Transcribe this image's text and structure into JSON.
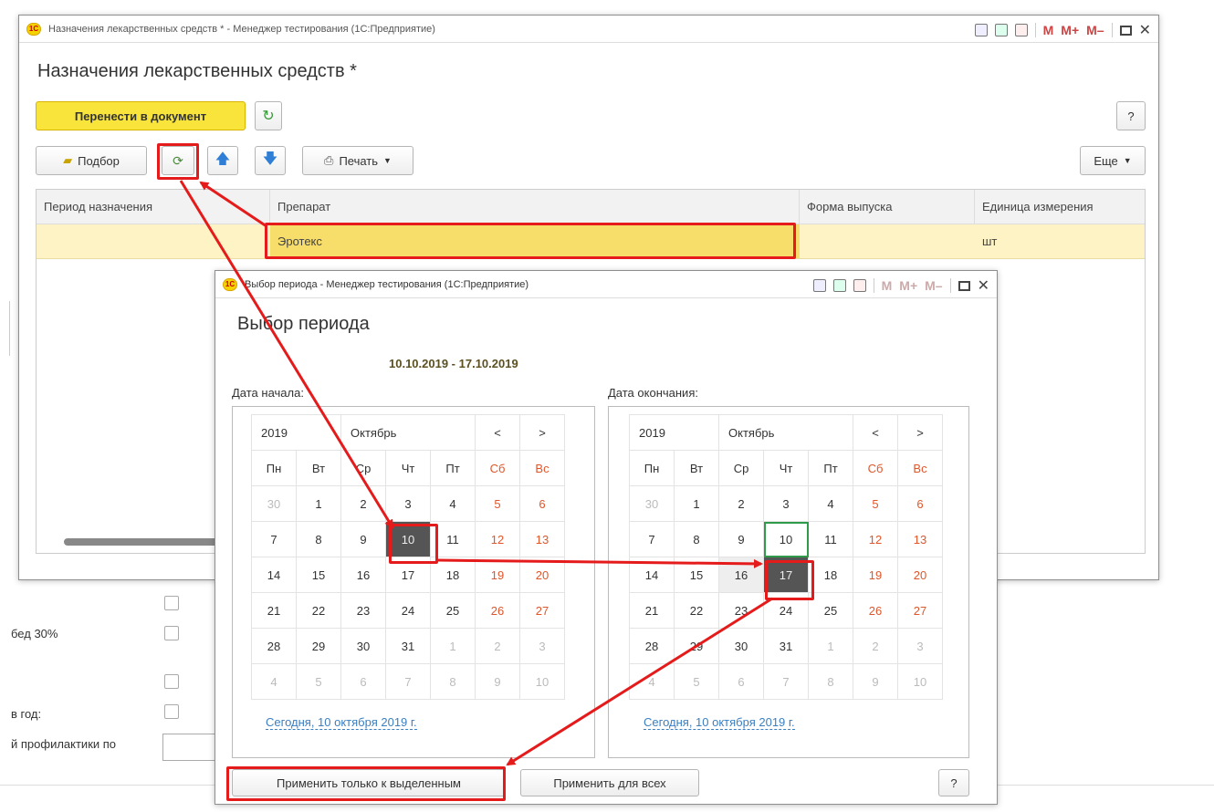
{
  "main_window": {
    "title": "Назначения лекарственных средств * - Менеджер тестирования (1С:Предприятие)",
    "heading": "Назначения лекарственных средств *",
    "transfer_button": "Перенести в документ",
    "help_button": "?",
    "toolbar": {
      "pick_label": "Подбор",
      "print_label": "Печать",
      "more_label": "Еще"
    },
    "table": {
      "columns": [
        "Период назначения",
        "Препарат",
        "Форма выпуска",
        "Единица измерения"
      ],
      "rows": [
        {
          "period": "",
          "drug": "Эротекс",
          "form": "",
          "unit": "шт"
        }
      ]
    }
  },
  "background_form": {
    "labels": [
      "бед 30%",
      "в год:",
      "й профилактики по"
    ]
  },
  "period_dialog": {
    "title": "Выбор периода - Менеджер тестирования (1С:Предприятие)",
    "heading": "Выбор периода",
    "range_text": "10.10.2019 - 17.10.2019",
    "start_label": "Дата начала:",
    "end_label": "Дата окончания:",
    "apply_selected": "Применить только к выделенным",
    "apply_all": "Применить для всех",
    "help": "?",
    "calendars": [
      {
        "year": "2019",
        "month": "Октябрь",
        "prev": "<",
        "next": ">",
        "weekdays": [
          "Пн",
          "Вт",
          "Ср",
          "Чт",
          "Пт",
          "Сб",
          "Вс"
        ],
        "weeks": [
          [
            "30",
            "1",
            "2",
            "3",
            "4",
            "5",
            "6"
          ],
          [
            "7",
            "8",
            "9",
            "10",
            "11",
            "12",
            "13"
          ],
          [
            "14",
            "15",
            "16",
            "17",
            "18",
            "19",
            "20"
          ],
          [
            "21",
            "22",
            "23",
            "24",
            "25",
            "26",
            "27"
          ],
          [
            "28",
            "29",
            "30",
            "31",
            "1",
            "2",
            "3"
          ],
          [
            "4",
            "5",
            "6",
            "7",
            "8",
            "9",
            "10"
          ]
        ],
        "today_link": "Сегодня, 10 октября 2019 г."
      },
      {
        "year": "2019",
        "month": "Октябрь",
        "prev": "<",
        "next": ">",
        "weekdays": [
          "Пн",
          "Вт",
          "Ср",
          "Чт",
          "Пт",
          "Сб",
          "Вс"
        ],
        "weeks": [
          [
            "30",
            "1",
            "2",
            "3",
            "4",
            "5",
            "6"
          ],
          [
            "7",
            "8",
            "9",
            "10",
            "11",
            "12",
            "13"
          ],
          [
            "14",
            "15",
            "16",
            "17",
            "18",
            "19",
            "20"
          ],
          [
            "21",
            "22",
            "23",
            "24",
            "25",
            "26",
            "27"
          ],
          [
            "28",
            "29",
            "30",
            "31",
            "1",
            "2",
            "3"
          ],
          [
            "4",
            "5",
            "6",
            "7",
            "8",
            "9",
            "10"
          ]
        ],
        "today_link": "Сегодня, 10 октября 2019 г."
      }
    ]
  },
  "titlebar_icons": [
    "print-icon",
    "calc-icon",
    "calendar-icon",
    "M",
    "M+",
    "M-",
    "maximize-icon",
    "close-icon"
  ],
  "colors": {
    "accent_yellow": "#f8e43b",
    "selected_row": "#fdf3c4",
    "annotation_red": "#e51b1b",
    "weekend": "#e0562a",
    "link": "#3a7fc2"
  }
}
